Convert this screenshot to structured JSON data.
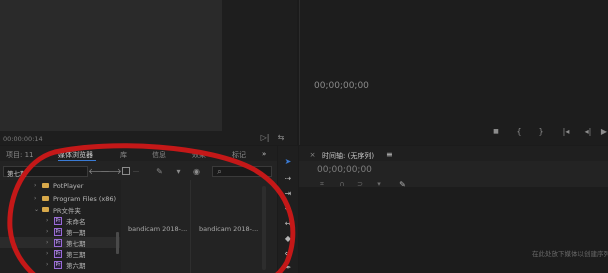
{
  "source_monitor": {
    "timecode": "00:00:00:14"
  },
  "program_monitor": {
    "timecode": "00;00;00;00"
  },
  "project_panel": {
    "tabs": [
      "项目: 11",
      "媒体浏览器",
      "库",
      "信息",
      "效果",
      "标记"
    ],
    "overflow": "»",
    "location_select": "第七期",
    "tree": [
      {
        "label": "PotPlayer",
        "kind": "folder"
      },
      {
        "label": "Program Files (x86)",
        "kind": "folder"
      },
      {
        "label": "PR文件夹",
        "kind": "folder-open"
      },
      {
        "label": "未命名",
        "kind": "pr"
      },
      {
        "label": "第一期",
        "kind": "pr"
      },
      {
        "label": "第七期",
        "kind": "pr"
      },
      {
        "label": "第三期",
        "kind": "pr"
      },
      {
        "label": "第六期",
        "kind": "pr"
      }
    ],
    "thumbnails": [
      "bandicam 2018-...",
      "bandicam 2018-..."
    ]
  },
  "timeline_panel": {
    "title": "时间轴: (无序列)",
    "menu_glyph": "≡",
    "timecode": "00;00;00;00",
    "hint": "在此处放下媒体以创建序列"
  },
  "colors": {
    "annotation_circle": "#c41818",
    "active_tab_underline": "#3a7bd5",
    "folder": "#d7a84a",
    "pr_badge": "#9a6bd8"
  }
}
